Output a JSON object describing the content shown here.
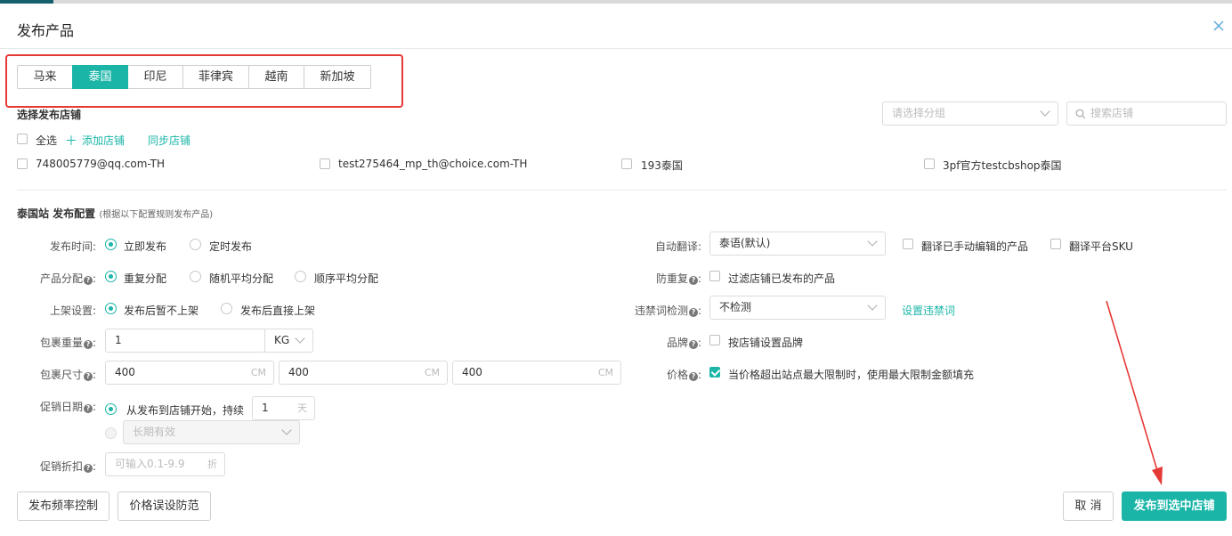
{
  "dialog": {
    "title": "发布产品",
    "close_icon": "close-icon"
  },
  "tabs": [
    {
      "label": "马来",
      "active": false
    },
    {
      "label": "泰国",
      "active": true
    },
    {
      "label": "印尼",
      "active": false
    },
    {
      "label": "菲律宾",
      "active": false
    },
    {
      "label": "越南",
      "active": false
    },
    {
      "label": "新加坡",
      "active": false
    }
  ],
  "store_section": {
    "title": "选择发布店铺",
    "group_placeholder": "请选择分组",
    "search_placeholder": "搜索店铺",
    "select_all": "全选",
    "add_store": "添加店铺",
    "sync_store": "同步店铺",
    "stores": [
      "748005779@qq.com-TH",
      "test275464_mp_th@choice.com-TH",
      "193泰国",
      "3pf官方testcbshop泰国"
    ]
  },
  "config": {
    "title": "泰国站 发布配置",
    "subtitle": "(根据以下配置规则发布产品)",
    "publish_time": {
      "label": "发布时间:",
      "options": [
        "立即发布",
        "定时发布"
      ],
      "selected": 0
    },
    "product_allocation": {
      "label": "产品分配",
      "options": [
        "重复分配",
        "随机平均分配",
        "顺序平均分配"
      ],
      "selected": 0
    },
    "listing": {
      "label": "上架设置",
      "options": [
        "发布后暂不上架",
        "发布后直接上架"
      ],
      "selected": 0
    },
    "weight": {
      "label": "包裹重量",
      "value": "1",
      "unit": "KG"
    },
    "size": {
      "label": "包裹尺寸",
      "values": [
        "400",
        "400",
        "400"
      ],
      "unit": "CM"
    },
    "promo_date": {
      "label": "促销日期",
      "option1": "从发布到店铺开始，持续",
      "days": "1",
      "days_unit": "天",
      "option2_value": "长期有效"
    },
    "promo_discount": {
      "label": "促销折扣",
      "placeholder": "可输入0.1-9.9",
      "unit": "折"
    },
    "auto_translate": {
      "label": "自动翻译:",
      "value": "泰语(默认)",
      "opt1": "翻译已手动编辑的产品",
      "opt2": "翻译平台SKU"
    },
    "dedupe": {
      "label": "防重复",
      "option": "过滤店铺已发布的产品"
    },
    "banned_words": {
      "label": "违禁词检测",
      "value": "不检测",
      "link": "设置违禁词"
    },
    "brand": {
      "label": "品牌",
      "option": "按店铺设置品牌"
    },
    "price": {
      "label": "价格",
      "option": "当价格超出站点最大限制时，使用最大限制金额填充",
      "checked": true
    }
  },
  "footer": {
    "freq_button": "发布频率控制",
    "price_guard_button": "价格误设防范",
    "cancel_button": "取 消",
    "publish_button": "发布到选中店铺"
  },
  "accent_color": "#1bb5a8",
  "annotation_color": "#e53935"
}
